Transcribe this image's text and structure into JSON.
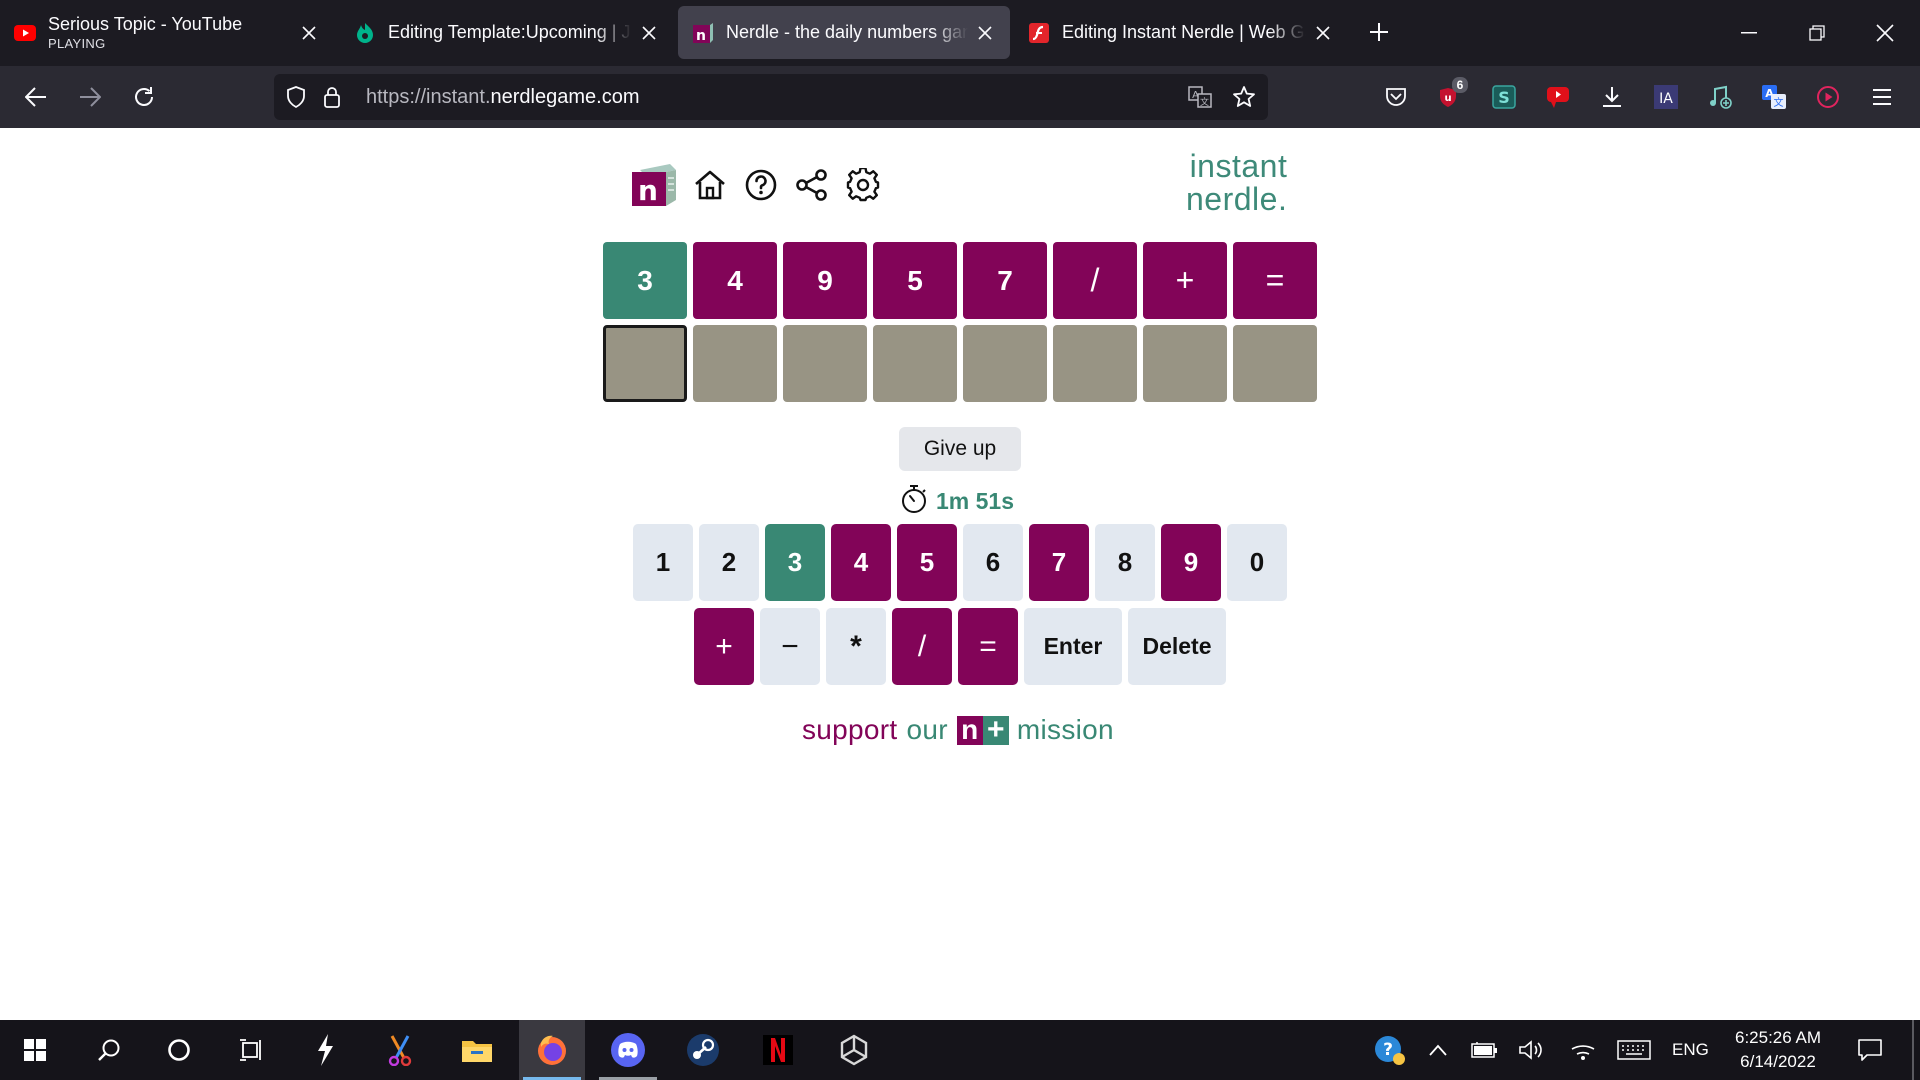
{
  "browser": {
    "tabs": [
      {
        "title": "Serious Topic - YouTube",
        "subtitle": "PLAYING",
        "favicon": "youtube-icon"
      },
      {
        "title": "Editing Template:Upcoming | Ju",
        "favicon": "fandom-icon"
      },
      {
        "title": "Nerdle - the daily numbers gam",
        "favicon": "nerdle-icon",
        "active": true
      },
      {
        "title": "Editing Instant Nerdle | Web Ga",
        "favicon": "flash-icon"
      }
    ],
    "url": {
      "prefix": "https://instant.",
      "domain": "nerdlegame.com"
    },
    "extension_badge": "6"
  },
  "header": {
    "brand_line1": "instant",
    "brand_line2": "nerdle."
  },
  "board": {
    "row1": [
      "3",
      "4",
      "9",
      "5",
      "7",
      "/",
      "+",
      "="
    ],
    "row2": [
      "",
      "",
      "",
      "",
      "",
      "",
      "",
      ""
    ]
  },
  "controls": {
    "give_up": "Give up",
    "timer": "1m 51s"
  },
  "keyboard": {
    "row1": [
      "1",
      "2",
      "3",
      "4",
      "5",
      "6",
      "7",
      "8",
      "9",
      "0"
    ],
    "row2": [
      "+",
      "−",
      "*",
      "/",
      "=",
      "Enter",
      "Delete"
    ]
  },
  "footer": {
    "support": "support",
    "our": "our",
    "n": "n",
    "plus": "+",
    "mission": "mission"
  },
  "taskbar": {
    "language": "ENG",
    "time": "6:25:26 AM",
    "date": "6/14/2022"
  },
  "colors": {
    "purple": "#820458",
    "green": "#398874",
    "empty": "#989484",
    "key_light": "#e2e8f0"
  }
}
